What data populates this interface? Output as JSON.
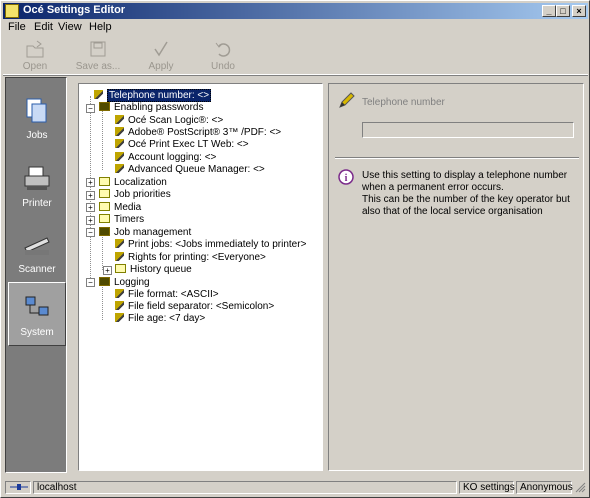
{
  "window": {
    "title": "Océ Settings Editor"
  },
  "menu": {
    "file": "File",
    "edit": "Edit",
    "view": "View",
    "help": "Help"
  },
  "toolbar": {
    "open": "Open",
    "save_as": "Save as...",
    "apply": "Apply",
    "undo": "Undo"
  },
  "nav": {
    "jobs": "Jobs",
    "printer": "Printer",
    "scanner": "Scanner",
    "system": "System"
  },
  "tree": {
    "telephone": "Telephone number: <>",
    "enabling_passwords": "Enabling passwords",
    "scan_logic": "Océ Scan Logic®: <>",
    "postscript": "Adobe® PostScript® 3™ /PDF: <>",
    "print_exec": "Océ Print Exec LT Web: <>",
    "account_logging": "Account logging: <>",
    "advanced_queue": "Advanced Queue Manager: <>",
    "localization": "Localization",
    "job_priorities": "Job priorities",
    "media": "Media",
    "timers": "Timers",
    "job_management": "Job management",
    "print_jobs": "Print jobs: <Jobs immediately to printer>",
    "rights": "Rights for printing: <Everyone>",
    "history_queue": "History queue",
    "logging": "Logging",
    "file_format": "File format: <ASCII>",
    "field_separator": "File field separator: <Semicolon>",
    "file_age": "File age: <7 day>"
  },
  "detail": {
    "label": "Telephone number",
    "value": "",
    "info_lines": [
      "Use this setting to display a telephone number",
      "when a permanent error occurs.",
      "This can be the number of the key operator but",
      "also that of the local service organisation"
    ]
  },
  "status": {
    "host": "localhost",
    "settings": "KO settings",
    "user": "Anonymous"
  }
}
